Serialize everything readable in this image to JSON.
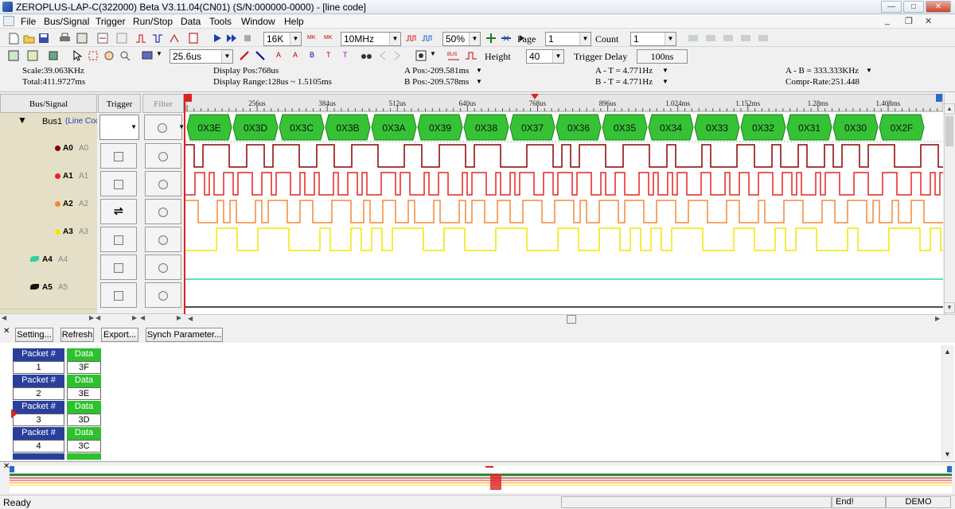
{
  "window": {
    "title": "ZEROPLUS-LAP-C(322000) Beta V3.11.04(CN01) (S/N:000000-0000) - [line code]"
  },
  "menu": [
    "File",
    "Bus/Signal",
    "Trigger",
    "Run/Stop",
    "Data",
    "Tools",
    "Window",
    "Help"
  ],
  "toolbar1": {
    "memory_depth": "16K",
    "sample_rate": "10MHz",
    "trigger_pos": "50%",
    "page_label": "Page",
    "page_value": "1",
    "count_label": "Count",
    "count_value": "1"
  },
  "toolbar2": {
    "time_per_div": "25.6us",
    "height_label": "Height",
    "height_value": "40",
    "trigger_delay_label": "Trigger Delay",
    "trigger_delay_value": "100ns"
  },
  "info": {
    "scale": "Scale:39.063KHz",
    "total": "Total:411.9727ms",
    "display_pos": "Display Pos:768us",
    "display_range": "Display Range:128us ~ 1.5105ms",
    "a_pos": "A Pos:-209.581ms",
    "b_pos": "B Pos:-209.578ms",
    "a_t": "A - T = 4.771Hz",
    "b_t": "B - T = 4.771Hz",
    "a_b": "A - B = 333.333KHz",
    "compr_rate": "Compr-Rate:251.448"
  },
  "columns": {
    "bus_signal": "Bus/Signal",
    "trigger": "Trigger",
    "filter": "Filter"
  },
  "bus": {
    "name": "Bus1",
    "decoder": "(Line Coc"
  },
  "signals": [
    {
      "name": "A0",
      "channel": "A0",
      "color": "#8b0000"
    },
    {
      "name": "A1",
      "channel": "A1",
      "color": "#e52421"
    },
    {
      "name": "A2",
      "channel": "A2",
      "color": "#f08a3c"
    },
    {
      "name": "A3",
      "channel": "A3",
      "color": "#f3e600"
    },
    {
      "name": "A4",
      "channel": "A4",
      "color": "#2ed3a0"
    },
    {
      "name": "A5",
      "channel": "A5",
      "color": "#111111"
    }
  ],
  "ruler_ticks": [
    "256us",
    "384us",
    "512us",
    "640us",
    "768us",
    "896us",
    "1.024ms",
    "1.152ms",
    "1.28ms",
    "1.408ms"
  ],
  "bus_values": [
    "0X3E",
    "0X3D",
    "0X3C",
    "0X3B",
    "0X3A",
    "0X39",
    "0X38",
    "0X37",
    "0X36",
    "0X35",
    "0X34",
    "0X33",
    "0X32",
    "0X31",
    "0X30",
    "0X2F"
  ],
  "packet_buttons": {
    "setting": "Setting...",
    "refresh": "Refresh",
    "export": "Export...",
    "synch": "Synch Parameter..."
  },
  "packets": {
    "packet_label": "Packet #",
    "data_label": "Data",
    "rows": [
      {
        "num": "1",
        "data": "3F"
      },
      {
        "num": "2",
        "data": "3E"
      },
      {
        "num": "3",
        "data": "3D"
      },
      {
        "num": "4",
        "data": "3C"
      }
    ]
  },
  "status": {
    "ready": "Ready",
    "end": "End!",
    "mode": "DEMO"
  },
  "colors": {
    "bus_green": "#35c335",
    "packet_blue": "#2a3f9c",
    "packet_green": "#2ec12e",
    "signal_bg": "#e4dfc6"
  }
}
